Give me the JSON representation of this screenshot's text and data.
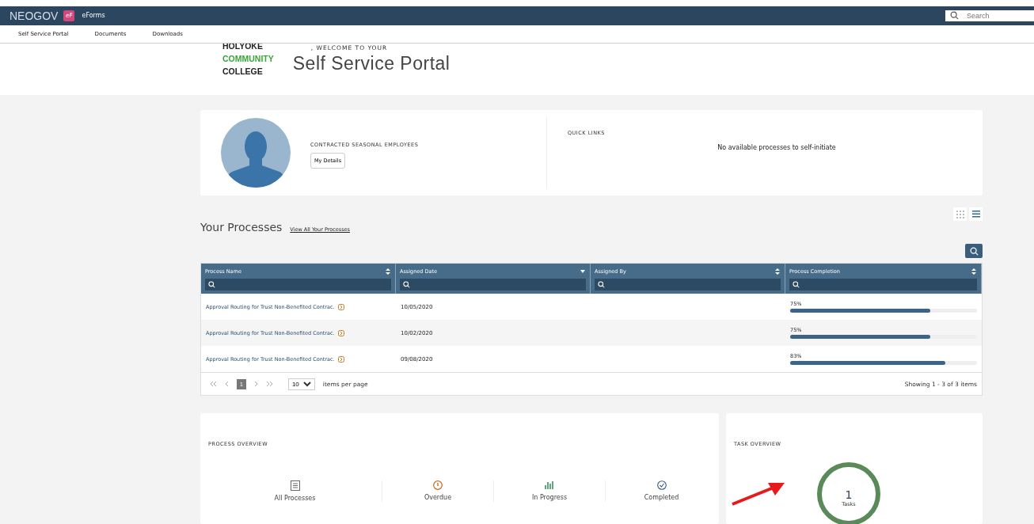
{
  "topbar": {
    "brand": "NEOGOV",
    "app_badge": "eF",
    "app_name": "eForms",
    "search": {
      "placeholder": "Search"
    }
  },
  "nav": [
    {
      "label": "Self Service Portal"
    },
    {
      "label": "Documents"
    },
    {
      "label": "Downloads"
    }
  ],
  "header": {
    "logo_lines": [
      "HOLYOKE",
      "COMMUNITY",
      "COLLEGE"
    ],
    "welcome": ", WELCOME TO YOUR",
    "title": "Self Service Portal"
  },
  "profile": {
    "group": "CONTRACTED SEASONAL EMPLOYEES",
    "button": "My Details"
  },
  "quick_links": {
    "title": "QUICK LINKS",
    "empty": "No available processes to self-initiate"
  },
  "view_toggle": [
    {
      "kind": "grid",
      "selected": false
    },
    {
      "kind": "list",
      "selected": true
    }
  ],
  "processes": {
    "title": "Your Processes",
    "link": "View All Your Processes",
    "columns": [
      {
        "label": "Process Name",
        "sorted": false
      },
      {
        "label": "Assigned Date",
        "sorted": true
      },
      {
        "label": "Assigned By",
        "sorted": false
      },
      {
        "label": "Process Completion",
        "sorted": false
      }
    ],
    "rows": [
      {
        "name": "Approval Routing for Trust Non-Benefited Contrac.",
        "date": "10/05/2020",
        "reading": "75%",
        "level": 0.75
      },
      {
        "name": "Approval Routing for Trust Non-Benefited Contrac.",
        "date": "10/02/2020",
        "reading": "75%",
        "level": 0.75
      },
      {
        "name": "Approval Routing for Trust Non-Benefited Contrac.",
        "date": "09/08/2020",
        "reading": "83%",
        "level": 0.83
      }
    ],
    "pages": [
      {
        "label": "1",
        "selected": true
      }
    ],
    "page_size": "10",
    "page_size_label": "items per page",
    "summary": "Showing 1 - 3 of 3 items"
  },
  "process_overview": {
    "title": "PROCESS OVERVIEW",
    "items": [
      {
        "kind": "all",
        "label": "All Processes"
      },
      {
        "kind": "overdue",
        "label": "Overdue"
      },
      {
        "kind": "progress",
        "label": "In Progress"
      },
      {
        "kind": "completed",
        "label": "Completed"
      }
    ]
  },
  "task_overview": {
    "title": "TASK OVERVIEW",
    "count": "1",
    "unit": "Tasks"
  }
}
